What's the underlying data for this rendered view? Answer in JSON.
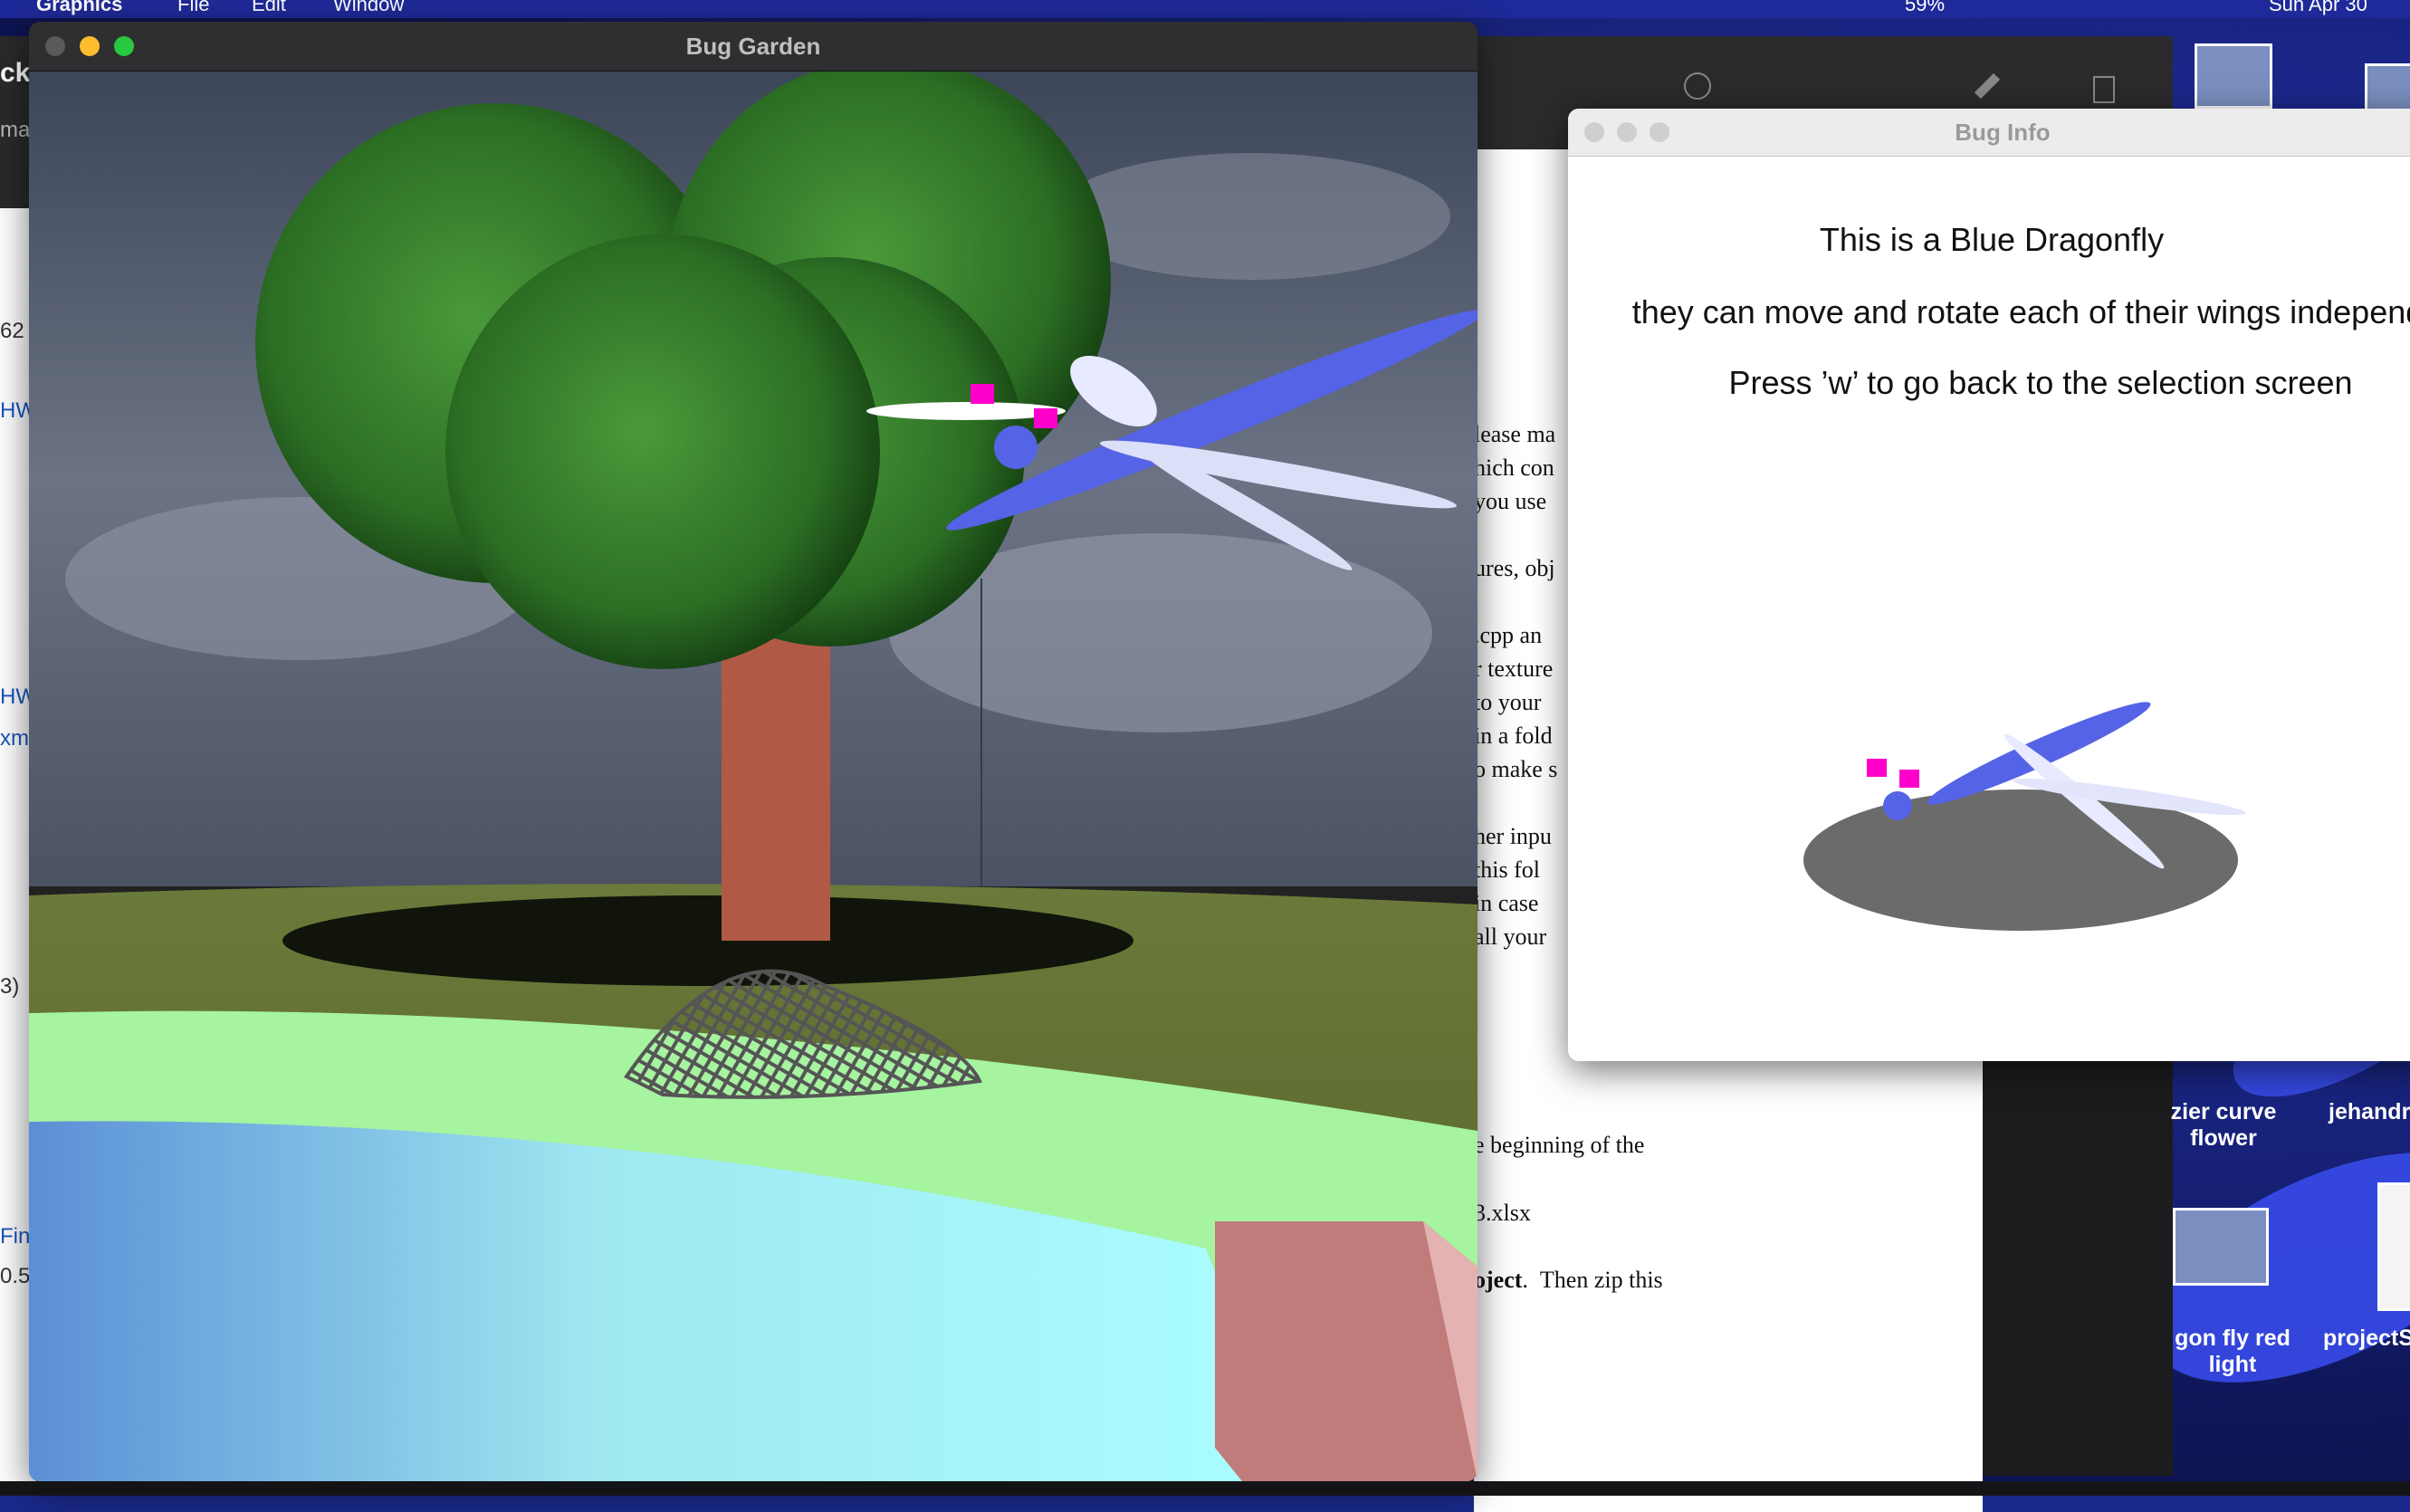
{
  "menubar": {
    "app": "Graphics",
    "items": [
      "File",
      "Edit",
      "Window"
    ],
    "battery": "59%",
    "clock": "Sun Apr 30"
  },
  "garden_window": {
    "title": "Bug Garden"
  },
  "info_window": {
    "title": "Bug Info",
    "heading": "This is a Blue Dragonfly",
    "description": "they can move and rotate each of their wings independe",
    "instruction": "Press ’w’ to go back to the selection screen"
  },
  "background_document": {
    "lines": [
      "lease ma",
      "hich con",
      "you use",
      "ures, obj",
      ".cpp an",
      "r texture",
      "to your",
      "in a fold",
      "o make s",
      "her inpu",
      "this fol",
      "in case",
      "all your",
      "e beginning of the",
      "3.xlsx",
      "Then zip this"
    ],
    "bold_word": "oject"
  },
  "left_app": {
    "fragments": [
      "ckb",
      "ma",
      "62",
      "HW",
      "HW",
      "xm",
      "3)",
      "Fin",
      "0.5"
    ]
  },
  "desktop": {
    "icons": [
      {
        "label_line1": "zier curve",
        "label_line2": "flower"
      },
      {
        "label_line1": "jehandr",
        "label_line2": ""
      },
      {
        "label_line1": "gon fly red",
        "label_line2": "light"
      },
      {
        "label_line1": "projectS",
        "label_line2": ""
      }
    ]
  },
  "colors": {
    "close": "#ff5f57",
    "minimize": "#febc2e",
    "zoom": "#28c840",
    "dragonfly_body": "#5563e6",
    "dragonfly_head": "#ff00cc",
    "trunk": "#b05a45"
  }
}
